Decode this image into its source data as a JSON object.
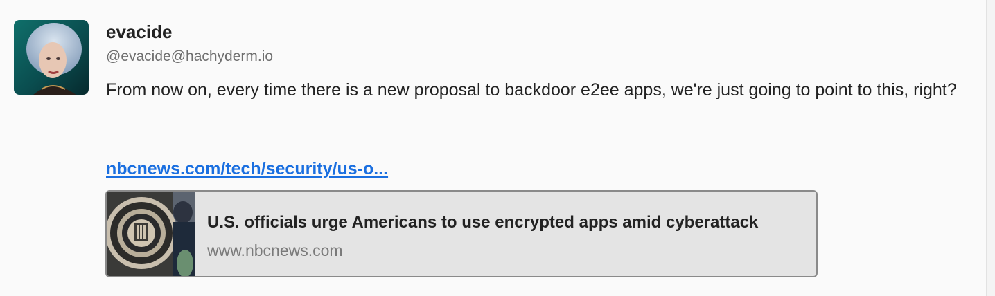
{
  "post": {
    "author": {
      "display_name": "evacide",
      "handle": "@evacide@hachyderm.io",
      "avatar_icon": "user-avatar-photo"
    },
    "text": "From now on, every time there is a new proposal to backdoor e2ee apps, we're just going to point to this, right?",
    "link_text": "nbcnews.com/tech/security/us-o...",
    "link_color": "#1a6fe0",
    "preview_card": {
      "title": "U.S. officials urge Americans to use encrypted apps amid cyberattack",
      "domain": "www.nbcnews.com",
      "thumbnail_icon": "fbi-seal-thumbnail"
    }
  }
}
